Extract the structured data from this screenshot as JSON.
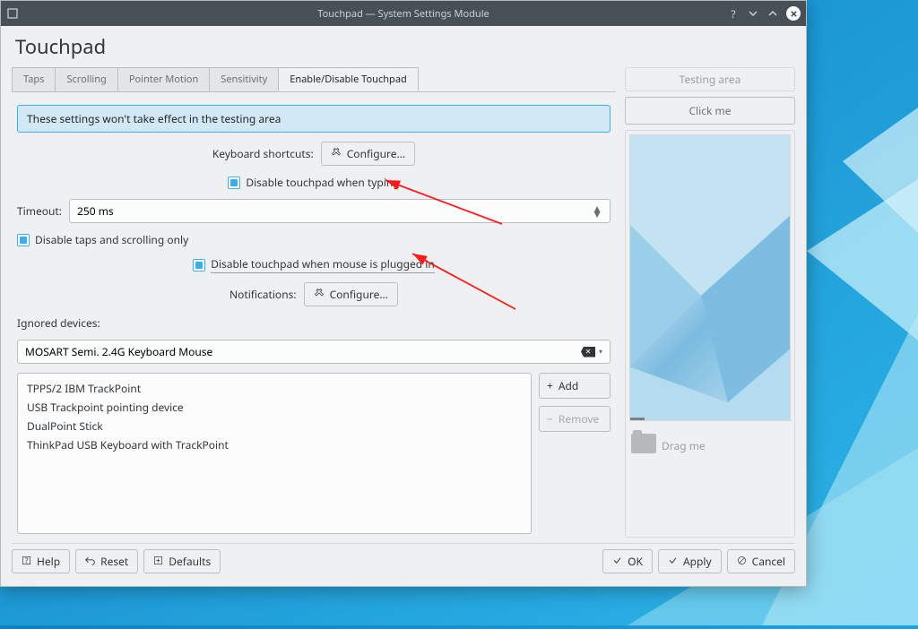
{
  "window": {
    "title": "Touchpad — System Settings Module"
  },
  "page": {
    "title": "Touchpad"
  },
  "tabs": {
    "items": [
      {
        "label": "Taps",
        "active": false
      },
      {
        "label": "Scrolling",
        "active": false
      },
      {
        "label": "Pointer Motion",
        "active": false
      },
      {
        "label": "Sensitivity",
        "active": false
      },
      {
        "label": "Enable/Disable Touchpad",
        "active": true
      }
    ]
  },
  "content": {
    "info": "These settings won't take effect in the testing area",
    "keyboard_shortcuts_label": "Keyboard shortcuts:",
    "configure_btn": "Configure...",
    "disable_typing": "Disable touchpad when typing",
    "timeout_label": "Timeout:",
    "timeout_value": "250 ms",
    "disable_taps_scroll": "Disable taps and scrolling only",
    "disable_mouse": "Disable touchpad when mouse is plugged in",
    "notifications_label": "Notifications:",
    "ignored_label": "Ignored devices:",
    "ignored_combo": "MOSART Semi. 2.4G Keyboard Mouse",
    "device_list": [
      "TPPS/2 IBM TrackPoint",
      "USB Trackpoint pointing device",
      "DualPoint Stick",
      "ThinkPad USB Keyboard with TrackPoint"
    ],
    "add_btn": "Add",
    "remove_btn": "Remove"
  },
  "footer": {
    "help": "Help",
    "reset": "Reset",
    "defaults": "Defaults",
    "ok": "OK",
    "apply": "Apply",
    "cancel": "Cancel"
  },
  "testing": {
    "heading": "Testing area",
    "click_me": "Click me",
    "drag_me": "Drag me"
  }
}
